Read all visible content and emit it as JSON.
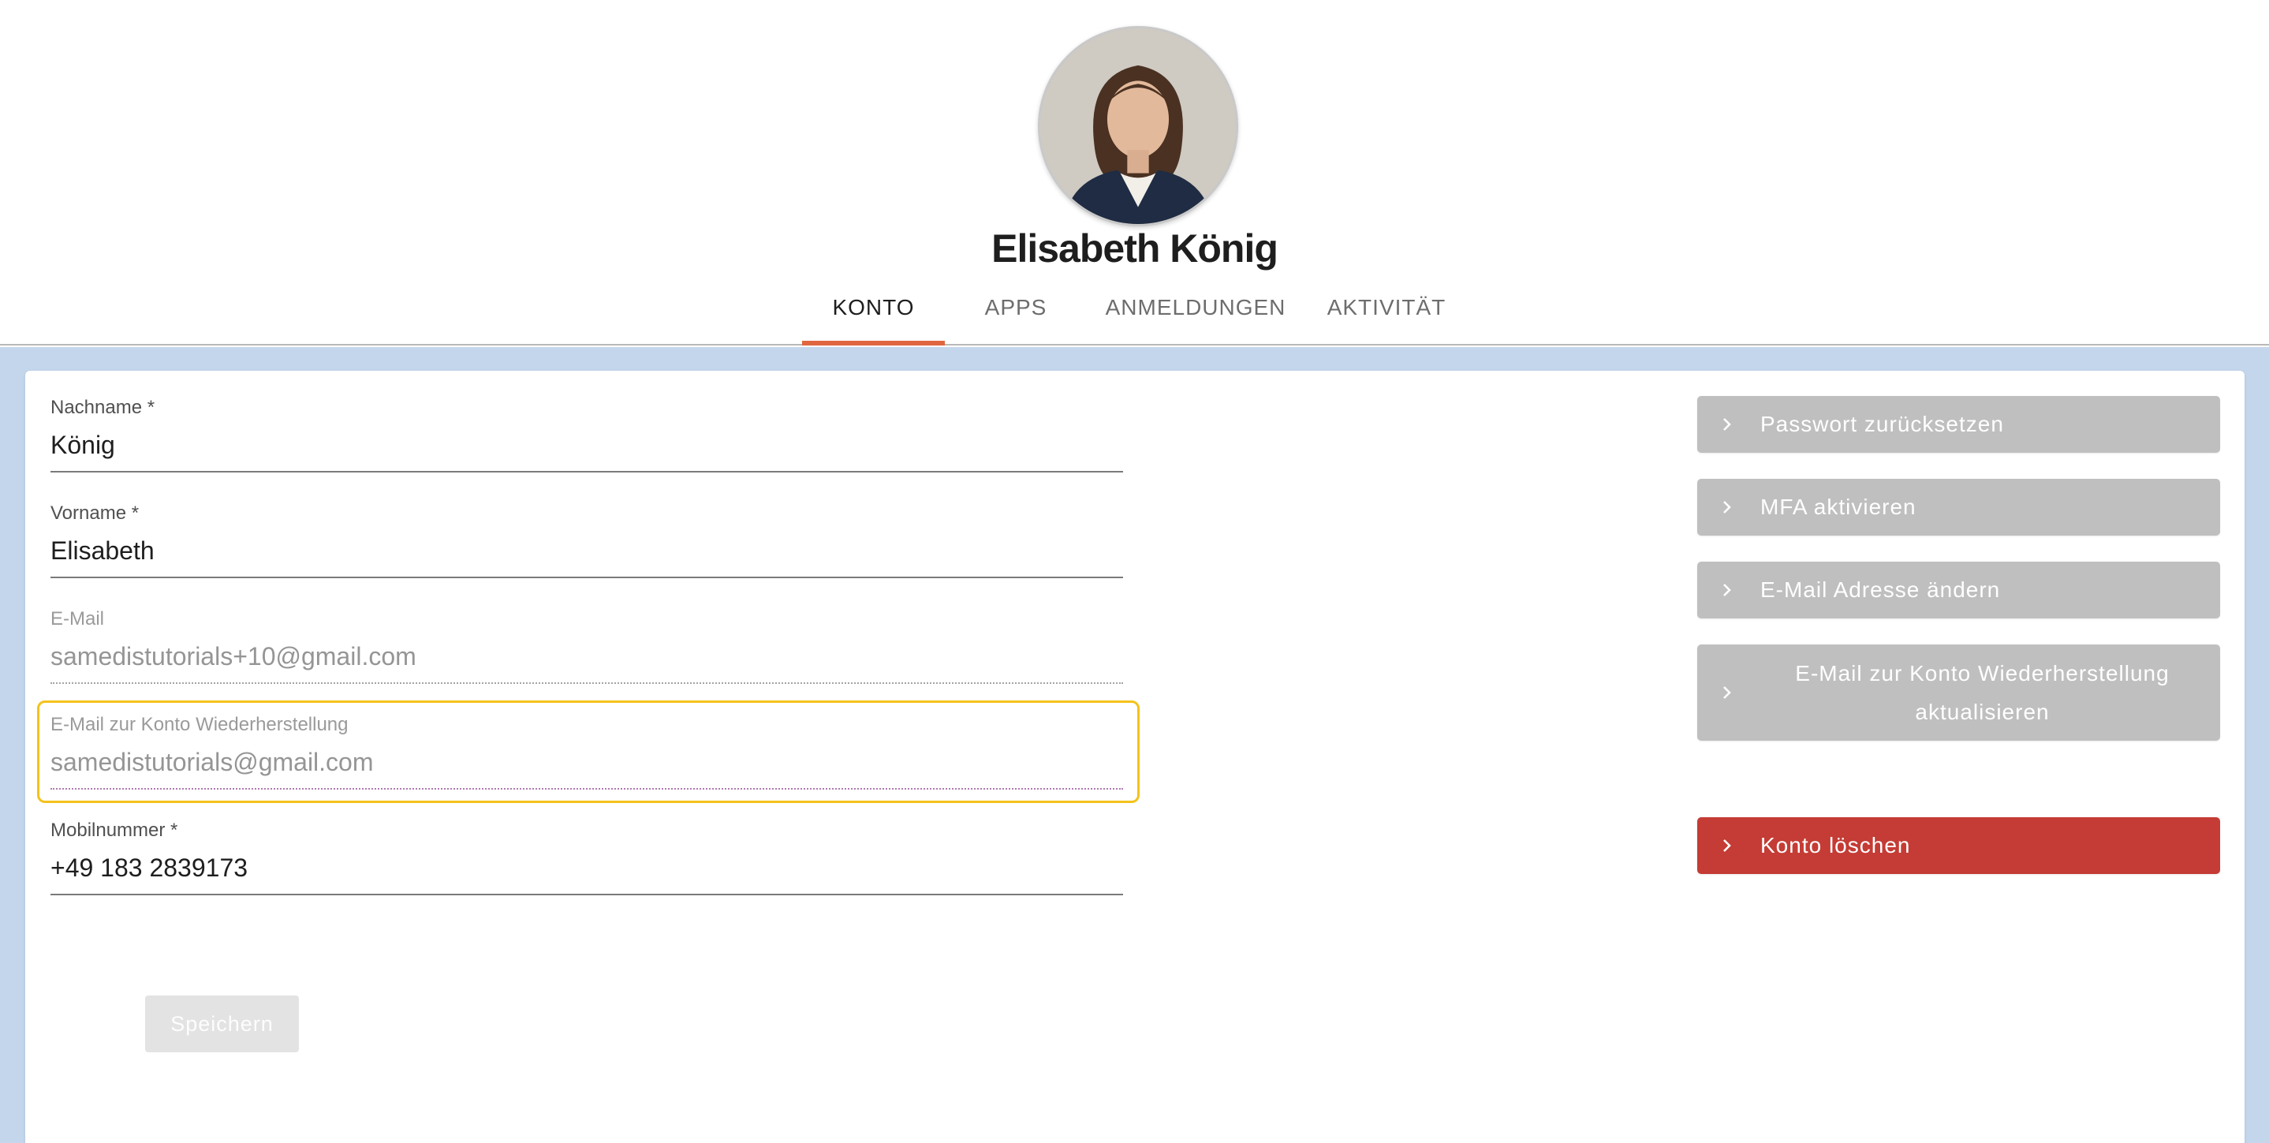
{
  "profile": {
    "name": "Elisabeth König"
  },
  "tabs": [
    {
      "label": "KONTO",
      "active": true
    },
    {
      "label": "APPS",
      "active": false
    },
    {
      "label": "ANMELDUNGEN",
      "active": false
    },
    {
      "label": "AKTIVITÄT",
      "active": false
    }
  ],
  "form": {
    "lastname": {
      "label": "Nachname *",
      "value": "König"
    },
    "firstname": {
      "label": "Vorname *",
      "value": "Elisabeth"
    },
    "email": {
      "label": "E-Mail",
      "value": "samedistutorials+10@gmail.com"
    },
    "recovery_email": {
      "label": "E-Mail zur Konto Wiederherstellung",
      "value": "samedistutorials@gmail.com"
    },
    "mobile": {
      "label": "Mobilnummer *",
      "value": "+49 183 2839173"
    },
    "save_label": "Speichern"
  },
  "actions": {
    "reset_password": "Passwort zurücksetzen",
    "enable_mfa": "MFA aktivieren",
    "change_email": "E-Mail Adresse ändern",
    "update_recovery_email": "E-Mail zur Konto Wiederherstellung aktualisieren",
    "delete_account": "Konto löschen"
  },
  "colors": {
    "page_background": "#c4d6ec",
    "tab_indicator": "#e0663f",
    "focus_outline": "#f4c21b",
    "action_button": "#bfbfbf",
    "danger_button": "#c43c35"
  },
  "icons": {
    "action_chevron": "chevron-right-icon"
  }
}
